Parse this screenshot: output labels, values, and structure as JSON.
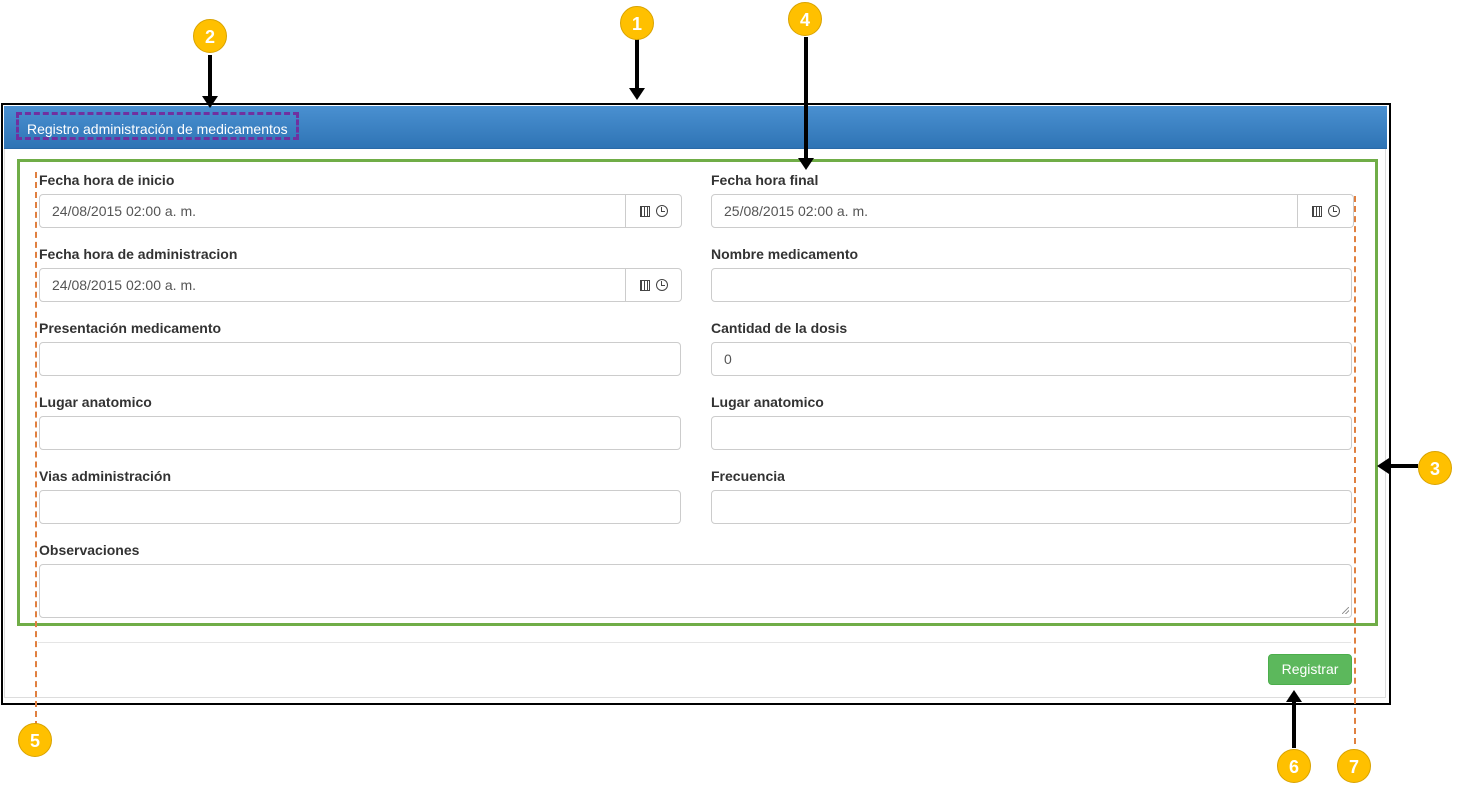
{
  "panel": {
    "title": "Registro administración de medicamentos"
  },
  "form": {
    "fecha_inicio": {
      "label": "Fecha hora de inicio",
      "value": "24/08/2015 02:00 a. m."
    },
    "fecha_final": {
      "label": "Fecha hora final",
      "value": "25/08/2015 02:00 a. m."
    },
    "fecha_administracion": {
      "label": "Fecha hora de administracion",
      "value": "24/08/2015 02:00 a. m."
    },
    "nombre_medicamento": {
      "label": "Nombre medicamento",
      "value": ""
    },
    "presentacion": {
      "label": "Presentación medicamento",
      "value": ""
    },
    "cantidad_dosis": {
      "label": "Cantidad de la dosis",
      "value": "0"
    },
    "lugar_anatomico_1": {
      "label": "Lugar anatomico",
      "value": ""
    },
    "lugar_anatomico_2": {
      "label": "Lugar anatomico",
      "value": ""
    },
    "vias": {
      "label": "Vias administración",
      "value": ""
    },
    "frecuencia": {
      "label": "Frecuencia",
      "value": ""
    },
    "observaciones": {
      "label": "Observaciones",
      "value": ""
    }
  },
  "actions": {
    "register_label": "Registrar"
  },
  "annotations": {
    "b1": "1",
    "b2": "2",
    "b3": "3",
    "b4": "4",
    "b5": "5",
    "b6": "6",
    "b7": "7"
  },
  "colors": {
    "header": "#337ab7",
    "success": "#5cb85c",
    "highlight_green": "#70ad47",
    "highlight_purple": "#7030a0",
    "badge": "#ffc000",
    "guide_orange": "#e08040"
  },
  "icons": [
    "calendar-icon",
    "clock-icon"
  ]
}
